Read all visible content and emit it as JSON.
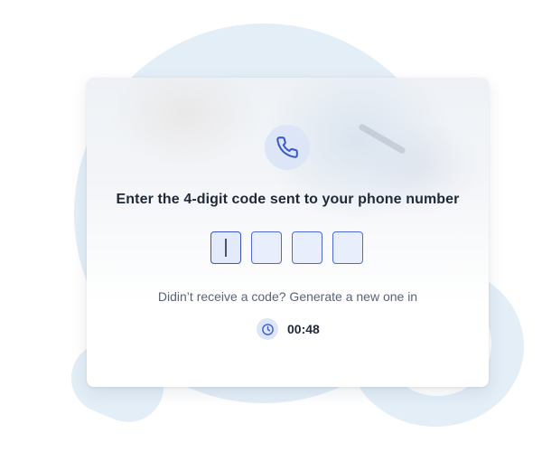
{
  "verification": {
    "heading": "Enter the 4-digit code sent to your phone number",
    "code_digits": [
      "",
      "",
      "",
      ""
    ],
    "active_digit_index": 0,
    "resend_text": "Didin’t receive a code? Generate a new one in",
    "timer": "00:48"
  },
  "icons": {
    "header": "phone-icon",
    "timer": "clock-icon"
  },
  "colors": {
    "accent": "#4d6bd6",
    "icon_bg": "#dde6f7",
    "blob": "#e3eef7",
    "text_dark": "#1f2a37",
    "text_muted": "#5a6475"
  }
}
